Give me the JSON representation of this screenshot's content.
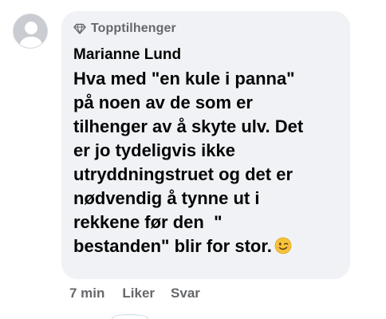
{
  "comment": {
    "badge_label": "Topptilhenger",
    "badge_icon": "diamond-icon",
    "author": "Marianne Lund",
    "body_lines": [
      "Hva med \"en kule i panna\"",
      "på noen av de som er",
      "tilhenger av å skyte ulv. Det",
      "er jo tydeligvis ikke",
      "utryddningstruet og det er",
      "nødvendig å tynne ut i",
      "rekkene før den  \"",
      "bestanden\" blir for stor."
    ],
    "emoji": "winking-face-emoji",
    "bubble_color": "#f0f2f5",
    "text_color": "#050505",
    "meta_color": "#65676b"
  },
  "actions": {
    "time": "7 min",
    "like_label": "Liker",
    "reply_label": "Svar"
  },
  "avatar": {
    "icon": "default-profile-icon"
  }
}
